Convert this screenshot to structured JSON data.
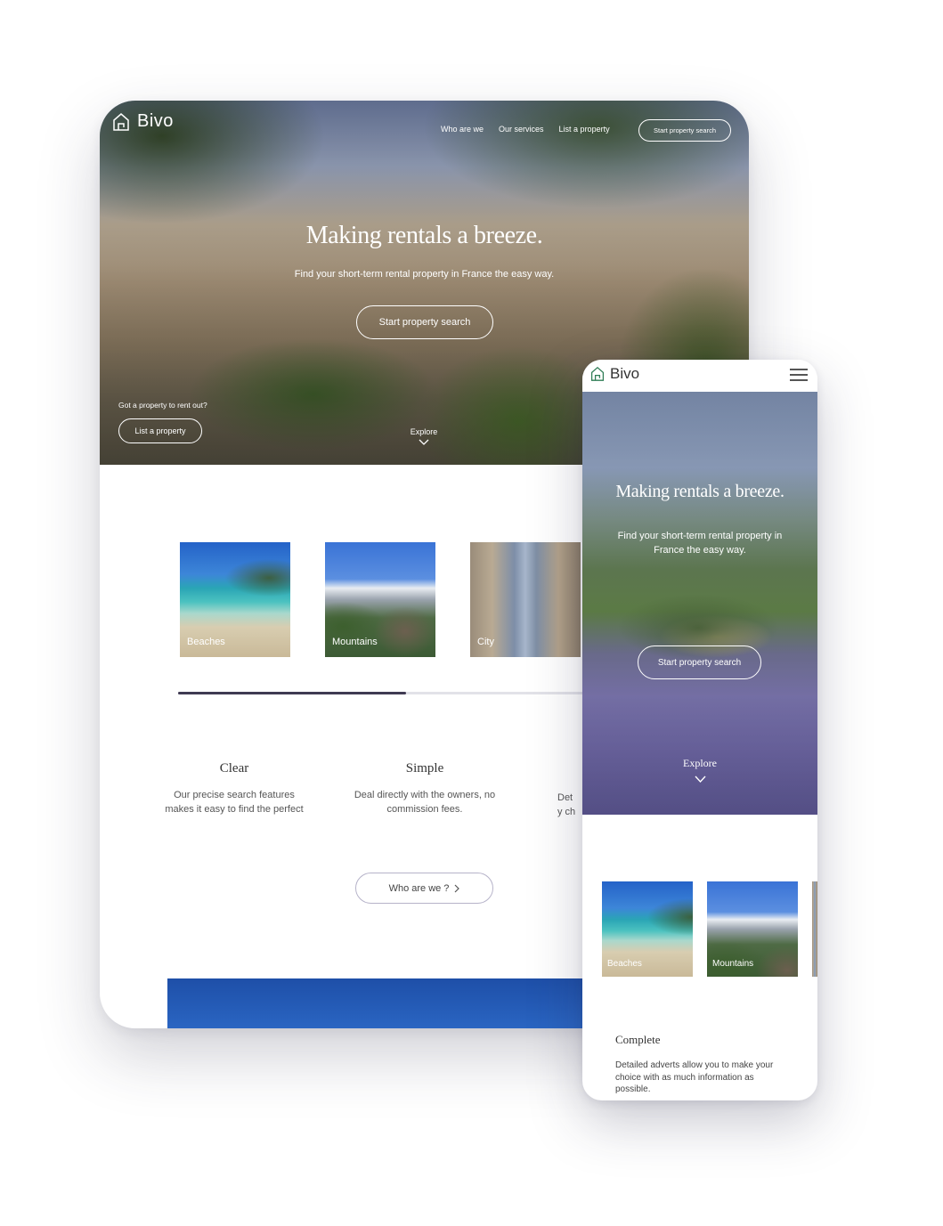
{
  "brand": {
    "name": "Bivo",
    "accent": "#3f3a52",
    "logo_icon": "house-icon"
  },
  "tablet": {
    "nav": [
      "Who are we",
      "Our services",
      "List a property"
    ],
    "nav_button": "Start property search",
    "hero_title": "Making rentals a breeze.",
    "hero_subtitle": "Find your short-term rental property in France the easy way.",
    "hero_cta": "Start property search",
    "owner_prompt": "Got a property to rent out?",
    "owner_button": "List a property",
    "explore": "Explore",
    "categories": [
      "Beaches",
      "Mountains",
      "City"
    ],
    "carousel_progress": 0.4,
    "features": [
      {
        "title": "Clear",
        "desc": "Our precise search features makes it easy to find the perfect"
      },
      {
        "title": "Simple",
        "desc": "Deal directly with the owners, no commission fees."
      },
      {
        "title": "",
        "desc": "Det y ch"
      }
    ],
    "about_button": "Who are we ?"
  },
  "phone": {
    "hero_title": "Making rentals a breeze.",
    "hero_subtitle": "Find your short-term rental property in France the easy way.",
    "hero_cta": "Start property search",
    "explore": "Explore",
    "categories": [
      "Beaches",
      "Mountains"
    ],
    "feature": {
      "title": "Complete",
      "desc": "Detailed adverts allow you to make your choice with as much information as possible."
    }
  }
}
